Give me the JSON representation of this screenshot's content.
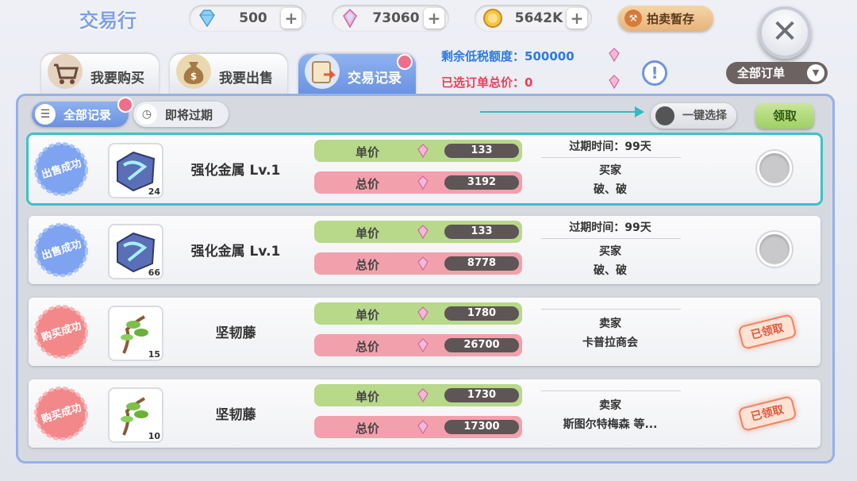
{
  "header": {
    "title": "交易行",
    "currencies": [
      {
        "icon": "diamond-icon",
        "value": "500",
        "plus": "+"
      },
      {
        "icon": "crystal-icon",
        "value": "73060",
        "plus": "+"
      },
      {
        "icon": "gold-coin-icon",
        "value": "5642K",
        "plus": "+"
      }
    ],
    "auction_label": "拍卖暂存",
    "close": "✕"
  },
  "tabs": [
    {
      "label": "我要购买",
      "active": false
    },
    {
      "label": "我要出售",
      "active": false
    },
    {
      "label": "交易记录",
      "active": true
    }
  ],
  "tax": {
    "remaining_label": "剩余低税额度：",
    "remaining_value": "500000",
    "selected_label": "已选订单总价：",
    "selected_value": "0",
    "remaining_color": "#2b7be0",
    "selected_color": "#e8405a"
  },
  "info": "!",
  "order_filter": {
    "label": "全部订单",
    "chevron": "▼"
  },
  "filters": {
    "all_records": "全部记录",
    "expiring": "即将过期",
    "select_all": "一键选择",
    "claim": "领取"
  },
  "price_labels": {
    "unit": "单价",
    "total": "总价"
  },
  "records": [
    {
      "status": "出售成功",
      "status_type": "sold",
      "item": "强化金属 Lv.1",
      "item_icon": "metal-ore-icon",
      "qty": "24",
      "unit_price": "133",
      "total_price": "3192",
      "expire": "过期时间：99天",
      "party_label": "买家",
      "party": "破、破",
      "selectable": true,
      "highlight": true
    },
    {
      "status": "出售成功",
      "status_type": "sold",
      "item": "强化金属 Lv.1",
      "item_icon": "metal-ore-icon",
      "qty": "66",
      "unit_price": "133",
      "total_price": "8778",
      "expire": "过期时间：99天",
      "party_label": "买家",
      "party": "破、破",
      "selectable": true,
      "highlight": false
    },
    {
      "status": "购买成功",
      "status_type": "bought",
      "item": "坚韧藤",
      "item_icon": "vine-icon",
      "qty": "15",
      "unit_price": "1780",
      "total_price": "26700",
      "expire": "",
      "party_label": "卖家",
      "party": "卡普拉商会",
      "claimed": "已领取",
      "selectable": false,
      "highlight": false
    },
    {
      "status": "购买成功",
      "status_type": "bought",
      "item": "坚韧藤",
      "item_icon": "vine-icon",
      "qty": "10",
      "unit_price": "1730",
      "total_price": "17300",
      "expire": "",
      "party_label": "卖家",
      "party": "斯图尔特梅森 等...",
      "claimed": "已领取",
      "selectable": false,
      "highlight": false
    }
  ],
  "colors": {
    "sold_seal": "#7ea3f0",
    "bought_seal": "#f2888a",
    "accent": "#6a92e0"
  }
}
